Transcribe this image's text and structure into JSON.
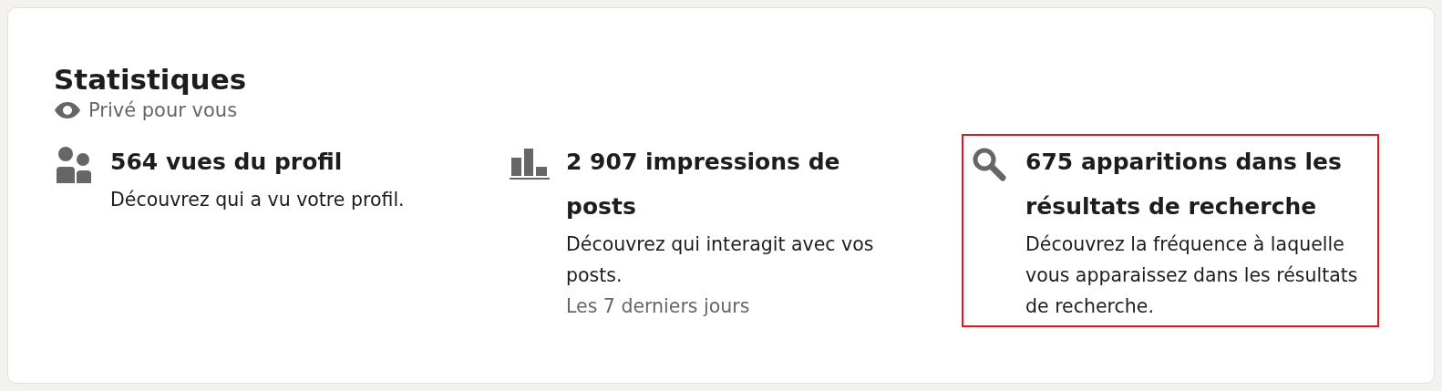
{
  "card": {
    "title": "Statistiques",
    "privacy_note": "Privé pour vous"
  },
  "stats": [
    {
      "kind": "profile-views",
      "headline": "564 vues du profil",
      "description": "Découvrez qui a vu votre profil.",
      "highlighted": false
    },
    {
      "kind": "post-impressions",
      "headline": "2 907 impressions de posts",
      "description": "Découvrez qui interagit avec vos posts.",
      "period": "Les 7 derniers jours",
      "highlighted": false
    },
    {
      "kind": "search-appearances",
      "headline": "675 apparitions dans les résultats de recherche",
      "description": "Découvrez la fréquence à laquelle vous apparaissez dans les résultats de recherche.",
      "highlighted": true
    }
  ]
}
